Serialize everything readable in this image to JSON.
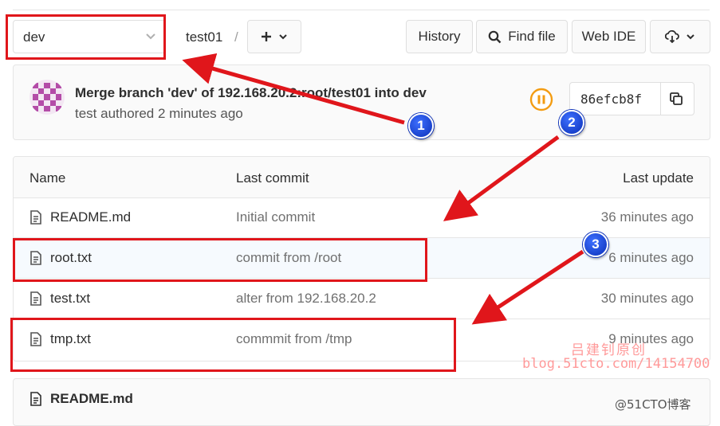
{
  "toolbar": {
    "branch": "dev",
    "project": "test01",
    "separator": "/",
    "history_label": "History",
    "find_file_label": "Find file",
    "web_ide_label": "Web IDE"
  },
  "commit": {
    "title": "Merge branch 'dev' of 192.168.20.2:root/test01 into dev",
    "meta": "test authored 2 minutes ago",
    "sha": "86efcb8f"
  },
  "table": {
    "headers": {
      "name": "Name",
      "last_commit": "Last commit",
      "last_update": "Last update"
    },
    "rows": [
      {
        "name": "README.md",
        "commit": "Initial commit",
        "time": "36 minutes ago"
      },
      {
        "name": "root.txt",
        "commit": "commit from /root",
        "time": "6 minutes ago"
      },
      {
        "name": "test.txt",
        "commit": "alter from 192.168.20.2",
        "time": "30 minutes ago"
      },
      {
        "name": "tmp.txt",
        "commit": "commmit from /tmp",
        "time": "9 minutes ago"
      }
    ]
  },
  "readme": {
    "title": "README.md"
  },
  "annotations": {
    "badge1": "1",
    "badge2": "2",
    "badge3": "3"
  },
  "watermark": {
    "line1": "吕建钊原创",
    "line2": "blog.51cto.com/14154700",
    "line3": "@51CTO博客"
  },
  "colors": {
    "annotation_red": "#e0161b",
    "badge_blue": "#0a2fb8",
    "pipeline_orange": "#f39c12"
  }
}
